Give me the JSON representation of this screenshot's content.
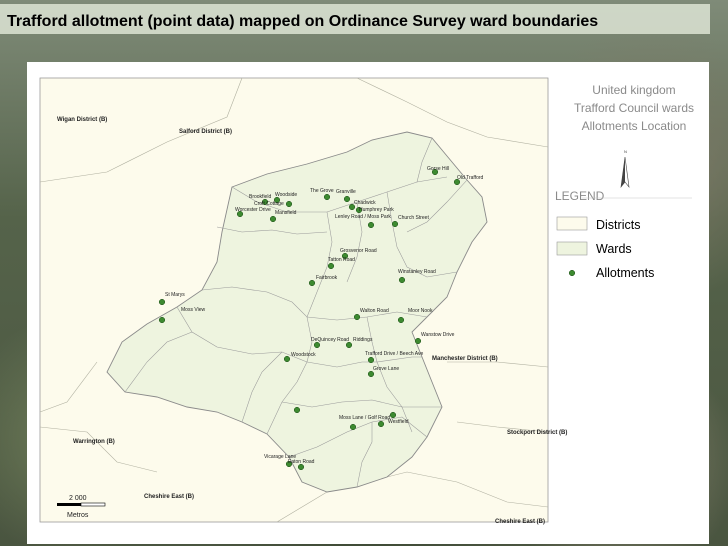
{
  "title": "Trafford allotment (point data) mapped on Ordinance Survey ward boundaries",
  "map_title": [
    "United kingdom",
    "Trafford Council wards",
    "Allotments Location"
  ],
  "north_label": "N",
  "legend": {
    "heading": "LEGEND",
    "items": [
      {
        "label": "Districts",
        "symbol": "district-box"
      },
      {
        "label": "Wards",
        "symbol": "ward-box"
      },
      {
        "label": "Allotments",
        "symbol": "dot"
      }
    ]
  },
  "scale_bar": {
    "value": "2 000",
    "unit": "Metros"
  },
  "colors": {
    "district_fill": "#fdfbec",
    "ward_fill": "#eef4df",
    "ward_line": "#8a8a8a",
    "allotment": "#3d8a30",
    "allotment_stroke": "#1f4e19"
  },
  "districts": [
    "Wigan District (B)",
    "Salford District (B)",
    "Manchester District (B)",
    "Warrington (B)",
    "Stockport District (B)",
    "Cheshire East (B)",
    "Cheshire East (B)"
  ],
  "allotment_labels": [
    "Gorse Hill",
    "Old Trafford",
    "The Grove",
    "Granville",
    "Brookfield",
    "Woodside",
    "Croft Cottage",
    "Worcester Drive",
    "Mansfield",
    "Chadwick",
    "Humphrey Park",
    "Lenley Road / Moss Park",
    "Church Street",
    "Grosvenor Road",
    "Tatton Road",
    "Fairbrook",
    "Winstanley Road",
    "St Marys",
    "Moss View",
    "Walton Road",
    "Moor Nook",
    "Wanstow Drive",
    "DeQuincey Road",
    "Riddings",
    "Woodstock",
    "Trafford Drive / Beech Ave",
    "Grove Lane",
    "Moss Lane / Golf Road",
    "Westfield",
    "Vicarage Lane",
    "Eaton Road"
  ]
}
